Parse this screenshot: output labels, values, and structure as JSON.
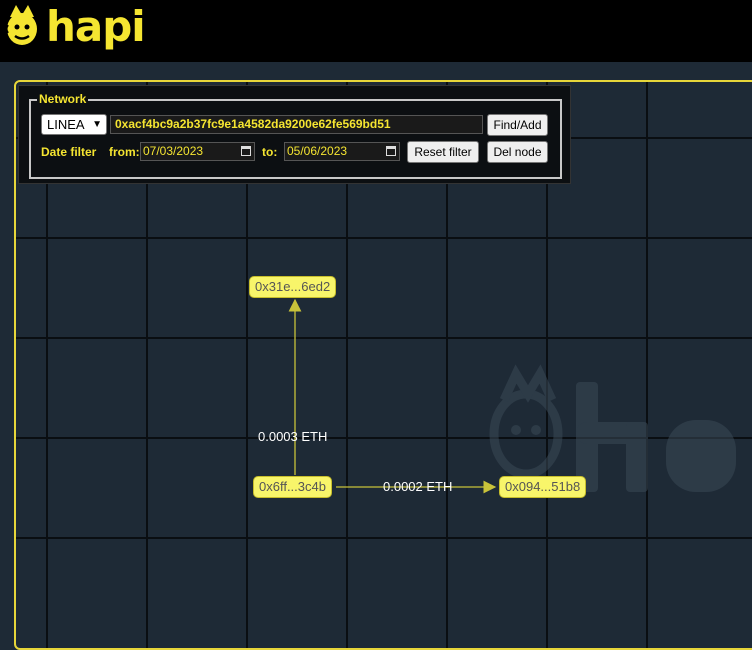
{
  "brand": {
    "name": "hapi",
    "color": "#f5e531"
  },
  "panel": {
    "legend": "Network",
    "network_select": "LINEA",
    "address_value": "0xacf4bc9a2b37fc9e1a4582da9200e62fe569bd51",
    "find_add_label": "Find/Add",
    "date_filter_label": "Date  filter",
    "from_label": "from:",
    "from_value": "07/03/2023",
    "to_label": "to:",
    "to_value": "05/06/2023",
    "reset_filter_label": "Reset filter",
    "del_node_label": "Del node"
  },
  "graph": {
    "nodes": [
      {
        "label": "0x31e...6ed2"
      },
      {
        "label": "0x6ff...3c4b"
      },
      {
        "label": "0x094...51b8"
      }
    ],
    "edges": [
      {
        "label": "0.0003 ETH"
      },
      {
        "label": "0.0002 ETH"
      }
    ]
  },
  "colors": {
    "accent": "#f5e531",
    "background": "#1e2a36",
    "node": "#f8f56a",
    "edge": "#c8c23a"
  }
}
